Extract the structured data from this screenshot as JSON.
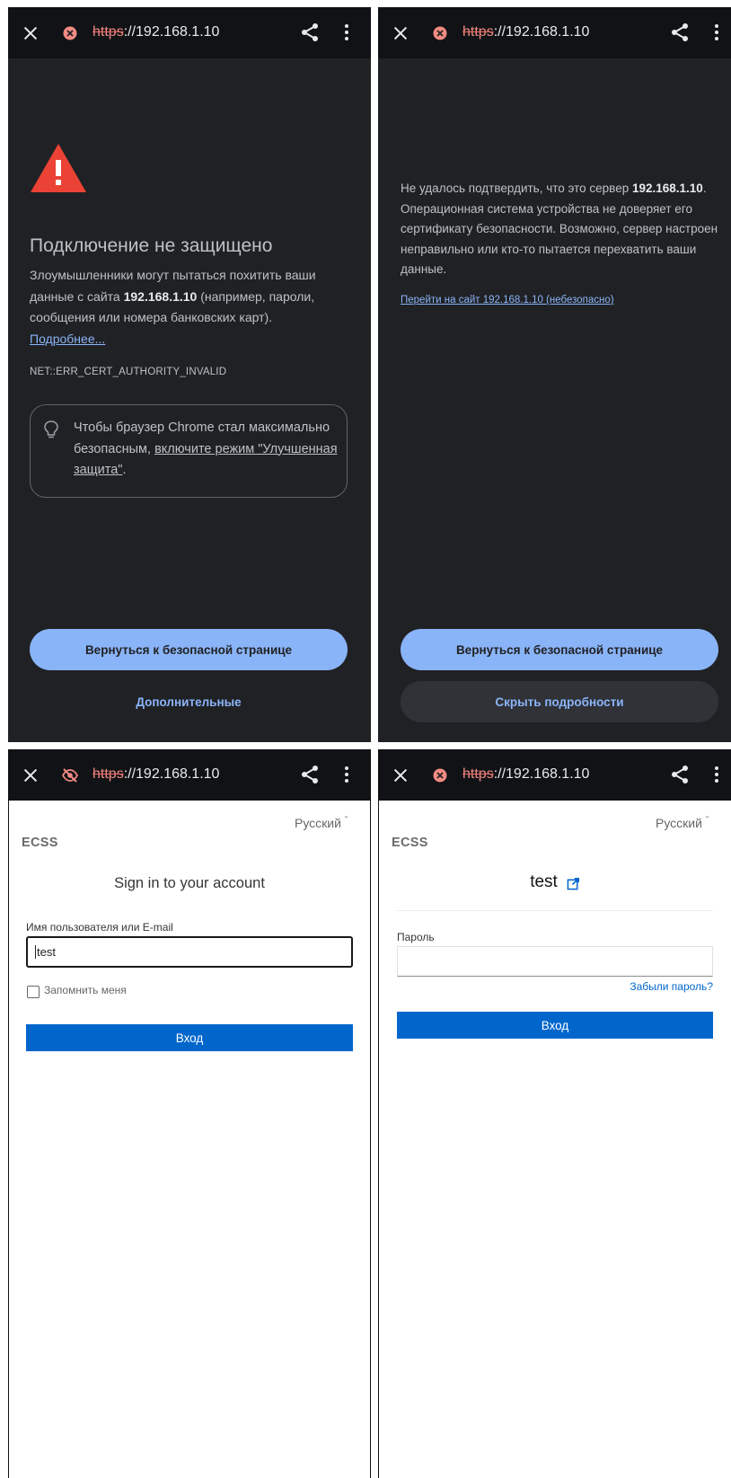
{
  "browser": {
    "url_scheme": "https",
    "url_rest": "://192.168.1.10",
    "icons": {
      "close": "close-icon",
      "security_error": "security-error-icon",
      "eye_off": "eye-off-icon",
      "share": "share-icon",
      "menu": "more-vert-icon"
    }
  },
  "interstitial": {
    "title": "Подключение не защищено",
    "desc_before": "Злоумышленники могут пытаться похитить ваши данные с сайта ",
    "desc_host": "192.168.1.10",
    "desc_after": " (например, пароли, сообщения или номера банковских карт).",
    "learn_more": "Подробнее...",
    "error_code": "NET::ERR_CERT_AUTHORITY_INVALID",
    "tip_before": "Чтобы браузер Chrome стал максимально безопасным, ",
    "tip_link": "включите режим \"Улучшенная защита\"",
    "tip_after": ".",
    "back_button": "Вернуться к безопасной странице",
    "advanced_button": "Дополнительные",
    "details_before": "Не удалось подтвердить, что это сервер ",
    "details_host": "192.168.1.10",
    "details_after": ". Операционная система устройства не доверяет его сертификату безопасности. Возможно, сервер настроен неправильно или кто-то пытается перехватить ваши данные.",
    "proceed_link": "Перейти на сайт 192.168.1.10 (небезопасно)",
    "hide_details_button": "Скрыть подробности"
  },
  "login": {
    "language": "Русский",
    "language_caret": "ˇ",
    "brand": "ECSS",
    "title": "Sign in to your account",
    "username_label": "Имя пользователя или E-mail",
    "username_value": "test",
    "remember_me": "Запомнить меня",
    "submit": "Вход"
  },
  "password_step": {
    "language": "Русский",
    "language_caret": "ˇ",
    "brand": "ECSS",
    "username": "test",
    "password_label": "Пароль",
    "password_value": "",
    "forgot": "Забыли пароль?",
    "submit": "Вход"
  },
  "colors": {
    "interstitial_bg": "#202124",
    "toolbar_bg": "#111216",
    "primary_button": "#8ab4f8",
    "danger_red": "#ea4335",
    "login_blue": "#0066cc"
  }
}
